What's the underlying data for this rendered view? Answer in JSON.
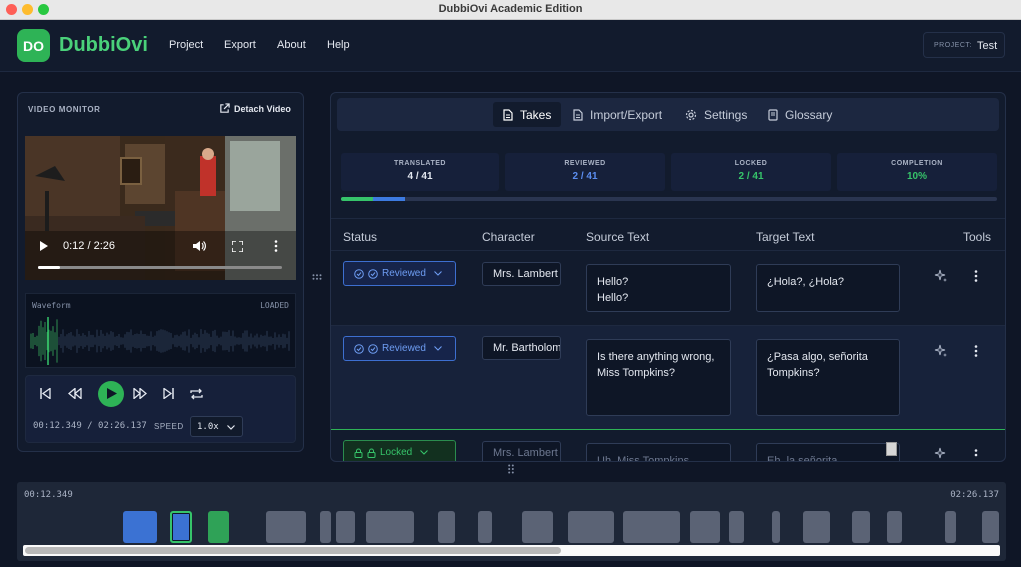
{
  "window": {
    "title": "DubbiOvi Academic Edition"
  },
  "app": {
    "logo_initials": "DO",
    "name": "DubbiOvi",
    "menu": [
      "Project",
      "Export",
      "About",
      "Help"
    ],
    "project_label": "PROJECT:",
    "project_name": "Test"
  },
  "video_monitor": {
    "title": "VIDEO MONITOR",
    "detach_label": "Detach Video",
    "player_time": "0:12 / 2:26",
    "player_progress": 0.09,
    "waveform_label": "Waveform",
    "waveform_status": "LOADED",
    "timecode": "00:12.349 / 02:26.137",
    "speed_label": "SPEED",
    "speed_value": "1.0x"
  },
  "tabs": [
    {
      "label": "Takes",
      "icon": "document-icon",
      "active": true
    },
    {
      "label": "Import/Export",
      "icon": "file-icon",
      "active": false
    },
    {
      "label": "Settings",
      "icon": "gear-icon",
      "active": false
    },
    {
      "label": "Glossary",
      "icon": "book-icon",
      "active": false
    }
  ],
  "stats": [
    {
      "label": "TRANSLATED",
      "value": "4 / 41",
      "color": "#e4e8f0"
    },
    {
      "label": "REVIEWED",
      "value": "2 / 41",
      "color": "#5b8def"
    },
    {
      "label": "LOCKED",
      "value": "2 / 41",
      "color": "#36c46a"
    },
    {
      "label": "COMPLETION",
      "value": "10%",
      "color": "#36c46a"
    }
  ],
  "progress": {
    "locked_fraction": 0.049,
    "reviewed_fraction": 0.049
  },
  "table": {
    "headers": [
      "Status",
      "Character",
      "Source Text",
      "Target Text",
      "Tools"
    ],
    "rows": [
      {
        "status": "Reviewed",
        "character": "Mrs. Lambert",
        "source": "Hello?\nHello?",
        "target": "¿Hola?, ¿Hola?"
      },
      {
        "status": "Reviewed",
        "character": "Mr. Bartholomew",
        "source": "Is there anything wrong, Miss Tompkins?",
        "target": "¿Pasa algo, señorita Tompkins?"
      },
      {
        "status": "Locked",
        "character": "Mrs. Lambert",
        "source": "Uh, Miss Tompkins",
        "target": "Eh, la señorita"
      }
    ]
  },
  "timeline": {
    "start_time": "00:12.349",
    "end_time": "02:26.137"
  },
  "colors": {
    "accent": "#2eb356",
    "reviewed": "#5b8def",
    "locked": "#36c46a"
  }
}
